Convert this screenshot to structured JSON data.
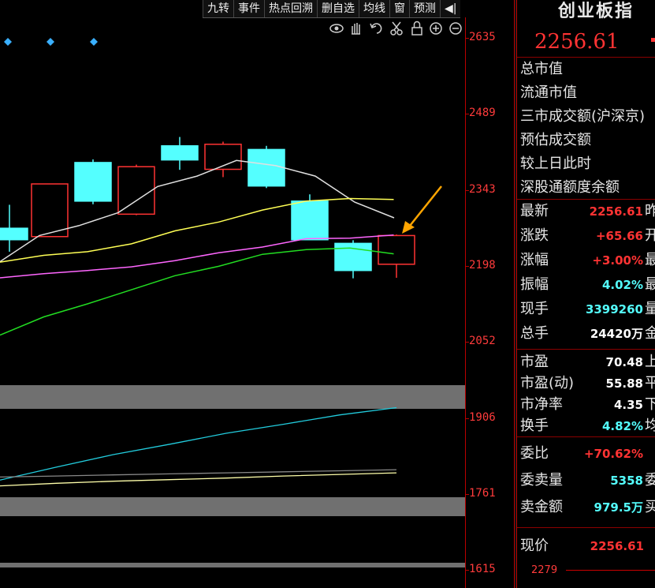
{
  "toolbar": {
    "items": [
      "九转",
      "事件",
      "热点回溯",
      "删自选",
      "均线",
      "窗",
      "预测"
    ],
    "arrow_label": "◀|"
  },
  "chart_icons": [
    "eye-icon",
    "hand-icon",
    "undo-icon",
    "scissors-icon",
    "lock-icon",
    "zoom-in-icon",
    "zoom-out-icon"
  ],
  "y_axis": {
    "labels": [
      "2635",
      "2489",
      "2343",
      "2198",
      "2052",
      "1906",
      "1761",
      "1615"
    ]
  },
  "chart_data": {
    "type": "candlestick",
    "ylim": [
      1615,
      2635
    ],
    "candles": [
      {
        "open": 2270,
        "close": 2248,
        "high": 2315,
        "low": 2225
      },
      {
        "open": 2254,
        "close": 2355,
        "high": 2355,
        "low": 2254
      },
      {
        "open": 2396,
        "close": 2322,
        "high": 2402,
        "low": 2316
      },
      {
        "open": 2297,
        "close": 2388,
        "high": 2392,
        "low": 2295
      },
      {
        "open": 2428,
        "close": 2401,
        "high": 2445,
        "low": 2382
      },
      {
        "open": 2383,
        "close": 2431,
        "high": 2436,
        "low": 2368
      },
      {
        "open": 2421,
        "close": 2351,
        "high": 2428,
        "low": 2347
      },
      {
        "open": 2322,
        "close": 2248,
        "high": 2335,
        "low": 2248
      },
      {
        "open": 2241,
        "close": 2189,
        "high": 2247,
        "low": 2174
      },
      {
        "open": 2201,
        "close": 2256,
        "high": 2258,
        "low": 2175
      }
    ],
    "ma_lines": [
      {
        "color": "#e0e0e0",
        "values": [
          2206,
          2256,
          2275,
          2300,
          2350,
          2370,
          2400,
          2390,
          2370,
          2320,
          2290
        ]
      },
      {
        "color": "#ffff55",
        "values": [
          2205,
          2218,
          2225,
          2240,
          2265,
          2282,
          2305,
          2322,
          2327,
          2325
        ]
      },
      {
        "color": "#ff66ff",
        "values": [
          2175,
          2183,
          2189,
          2196,
          2208,
          2223,
          2234,
          2250,
          2251,
          2257
        ]
      },
      {
        "color": "#22dd22",
        "values": [
          2065,
          2100,
          2125,
          2152,
          2179,
          2197,
          2220,
          2229,
          2232,
          2221
        ]
      }
    ],
    "indicator_lines": [
      {
        "color": "#22ccdd",
        "values": [
          1787,
          1812,
          1836,
          1856,
          1877,
          1894,
          1912,
          1926
        ]
      },
      {
        "color": "#888888",
        "values": [
          1793,
          1795,
          1797,
          1799,
          1801,
          1803,
          1805,
          1807
        ]
      },
      {
        "color": "#ffffaa",
        "values": [
          1776,
          1781,
          1785,
          1788,
          1791,
          1795,
          1798,
          1801
        ]
      }
    ]
  },
  "colors": {
    "up": "#ff3333",
    "down": "#54ffff",
    "arrow": "#ffa500",
    "diamond": "#3ab0ff"
  },
  "panel": {
    "title": "创业板指",
    "price": "2256.61",
    "labels_top": [
      "总市值",
      "流通市值",
      "三市成交额(沪深京)",
      "预估成交额",
      "较上日此时",
      "深股通额度余额"
    ],
    "rows": [
      {
        "label": "最新",
        "value": "2256.61",
        "color": "#ff3333",
        "tail": "昨"
      },
      {
        "label": "涨跌",
        "value": "+65.66",
        "color": "#ff3333",
        "tail": "开"
      },
      {
        "label": "涨幅",
        "value": "+3.00%",
        "color": "#ff3333",
        "tail": "最"
      },
      {
        "label": "振幅",
        "value": "4.02%",
        "color": "#54ffff",
        "tail": "最"
      },
      {
        "label": "现手",
        "value": "3399260",
        "color": "#54ffff",
        "tail": "量"
      },
      {
        "label": "总手",
        "value": "24420万",
        "color": "#ffffff",
        "tail": "金"
      }
    ],
    "rows2": [
      {
        "label": "市盈",
        "value": "70.48",
        "color": "#ffffff",
        "tail": "上"
      },
      {
        "label": "市盈(动)",
        "value": "55.88",
        "color": "#ffffff",
        "tail": "平"
      },
      {
        "label": "市净率",
        "value": "4.35",
        "color": "#ffffff",
        "tail": "下"
      },
      {
        "label": "换手",
        "value": "4.82%",
        "color": "#54ffff",
        "tail": "均"
      }
    ],
    "rows3": [
      {
        "label": "委比",
        "value": "+70.62%",
        "color": "#ff3333",
        "tail": ""
      },
      {
        "label": "委卖量",
        "value": "5358",
        "color": "#54ffff",
        "tail": "委"
      },
      {
        "label": "卖金额",
        "value": "979.5万",
        "color": "#54ffff",
        "tail": "买"
      }
    ],
    "current": {
      "label": "现价",
      "value": "2256.61"
    },
    "mini_label": "2279"
  }
}
